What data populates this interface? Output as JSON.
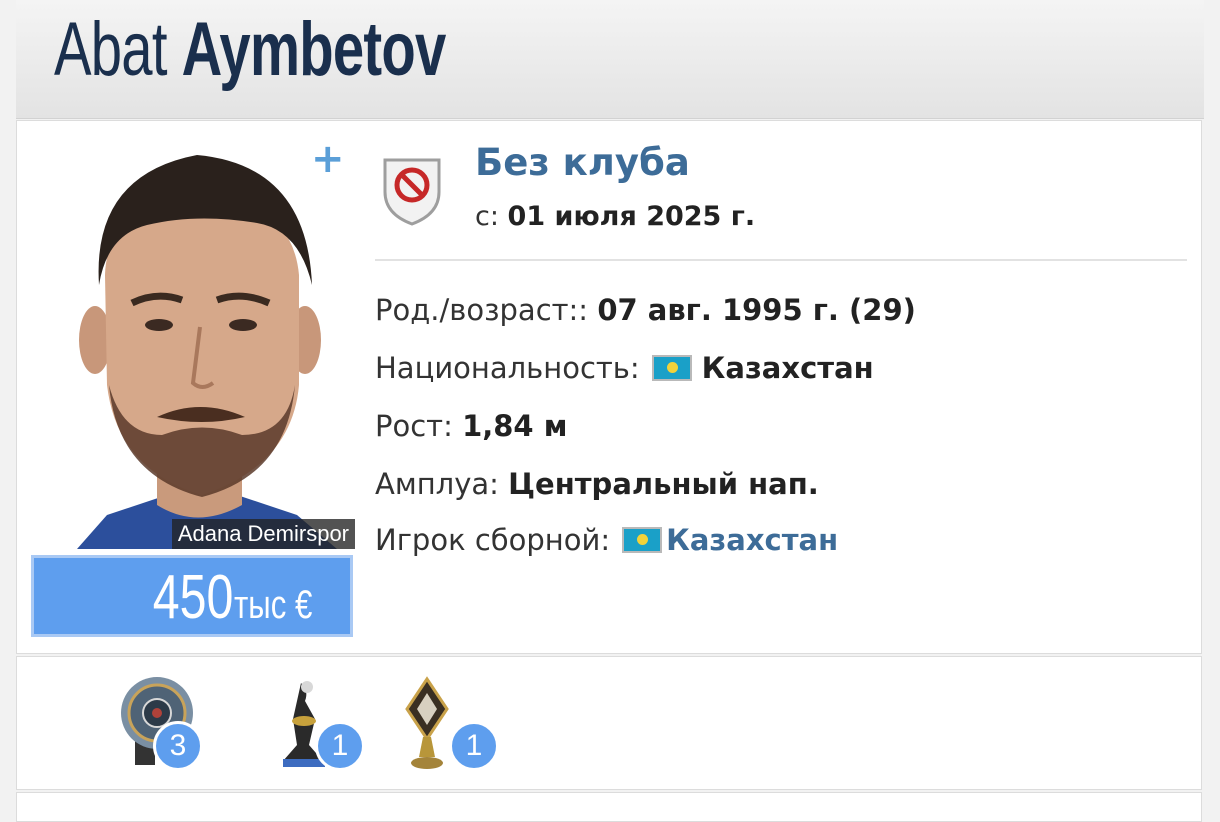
{
  "header": {
    "first_name": "Abat",
    "last_name": "Aymbetov"
  },
  "photo": {
    "club_caption": "Adana Demirspor",
    "add_icon": "plus-icon"
  },
  "market_value": {
    "amount": "450",
    "unit": "тыс €"
  },
  "club": {
    "name": "Без клуба",
    "since_label": "с:",
    "since_date": "01 июля 2025 г.",
    "icon": "no-club-shield-icon"
  },
  "info": {
    "birth_label": "Род./возраст::",
    "birth_value": "07 авг. 1995 г. (29)",
    "nationality_label": "Национальность:",
    "nationality_value": "Казахстан",
    "height_label": "Рост:",
    "height_value": "1,84 м",
    "position_label": "Амплуа:",
    "position_value": "Центральный нап.",
    "national_label": "Игрок сборной:",
    "national_value": "Казахстан",
    "flag_icon": "kazakhstan-flag-icon"
  },
  "trophies": [
    {
      "icon": "champion-plate-trophy-icon",
      "count": "3"
    },
    {
      "icon": "cup-trophy-icon",
      "count": "1"
    },
    {
      "icon": "diamond-trophy-icon",
      "count": "1"
    }
  ],
  "colors": {
    "accent_blue": "#5e9eee",
    "link_blue": "#3d6c98",
    "title_navy": "#1a2f4d"
  }
}
